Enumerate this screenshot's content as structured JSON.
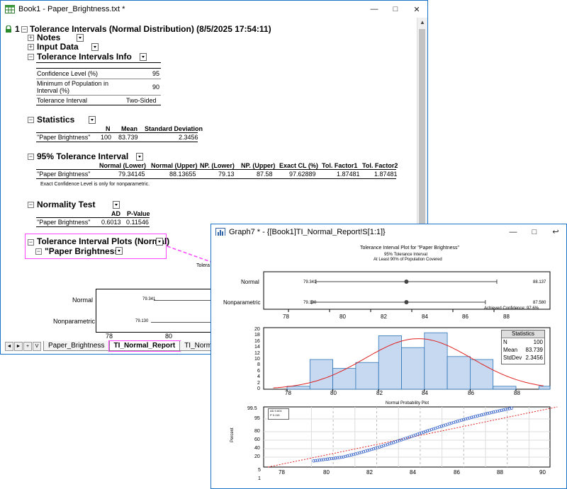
{
  "book": {
    "title": "Book1 - Paper_Brightness.txt *",
    "controls": [
      "—",
      "□",
      "✕"
    ],
    "root_num": "1",
    "header": "Tolerance Intervals (Normal Distribution) (8/5/2025 17:54:11)",
    "sections": {
      "notes": "Notes",
      "input": "Input Data",
      "info": "Tolerance Intervals Info",
      "stats": "Statistics",
      "ti": "95% Tolerance Interval",
      "norm": "Normality Test",
      "plots": "Tolerance Interval Plots (Normal)",
      "sub": "\"Paper Brightness\""
    },
    "info_rows": [
      {
        "label": "Confidence Level (%)",
        "value": "95"
      },
      {
        "label": "Minimum of Population in",
        "label2": "Interval (%)",
        "value": "90"
      },
      {
        "label": "Tolerance Interval",
        "value": "Two-Sided"
      }
    ],
    "stats_table": {
      "headers": [
        "N",
        "Mean",
        "Standard Deviation"
      ],
      "row_label": "\"Paper Brightness\"",
      "values": [
        "100",
        "83.739",
        "2.3456"
      ]
    },
    "ti_table": {
      "headers": [
        "Normal (Lower)",
        "Normal (Upper)",
        "NP. (Lower)",
        "NP. (Upper)",
        "Exact CL (%)",
        "Tol. Factor1",
        "Tol. Factor2"
      ],
      "row_label": "\"Paper Brightness\"",
      "values": [
        "79.34145",
        "88.13655",
        "79.13",
        "87.58",
        "97.62889",
        "1.87481",
        "1.87481"
      ],
      "note": "Exact Confidence Level is only for nonparametric."
    },
    "norm_table": {
      "headers": [
        "AD",
        "P-Value"
      ],
      "row_label": "\"Paper Brightness\"",
      "values": [
        "0.6013",
        "0.11546"
      ]
    },
    "partial_plot": {
      "title_frag": "Tolera",
      "frag2": "A",
      "rows": [
        "Normal",
        "Nonparametric"
      ],
      "left_vals": [
        "79.341",
        "79.130"
      ],
      "ticks": [
        "78",
        "80"
      ]
    },
    "tabs": [
      "Paper_Brightness",
      "TI_Normal_Report",
      "TI_Normal_Data"
    ],
    "nav_buttons": [
      "◄",
      "►",
      "+",
      "V"
    ]
  },
  "graph": {
    "title": "Graph7 * - {[Book1]TI_Normal_Report!S[1:1]}",
    "controls": [
      "—",
      "□",
      "↩"
    ],
    "layer_buttons": [
      "1",
      "2",
      "3"
    ],
    "plot_title": "Tolerance Interval Plot for \"Paper Brightness\"",
    "plot_sub1": "95% Tolerance Interval",
    "plot_sub2": "At Least 90% of Population Covered",
    "interval": {
      "rows": [
        "Normal",
        "Nonparametric"
      ],
      "left_labels": [
        "79.341",
        "79.130"
      ],
      "right_labels": [
        "88.137",
        "87.580"
      ],
      "achieved": "Achieved Confidence: 97.6%",
      "ticks": [
        "78",
        "80",
        "82",
        "84",
        "86",
        "88"
      ]
    },
    "hist": {
      "yticks": [
        "20",
        "18",
        "16",
        "14",
        "12",
        "10",
        "8",
        "6",
        "4",
        "2",
        "0"
      ],
      "xticks": [
        "78",
        "80",
        "82",
        "84",
        "86",
        "88"
      ],
      "stats_title": "Statistics",
      "stats": [
        [
          "N",
          "100"
        ],
        [
          "Mean",
          "83.739"
        ],
        [
          "StdDev",
          "2.3456"
        ]
      ]
    },
    "prob": {
      "title": "Normal Probability Plot",
      "ylabel": "Percent",
      "yticks": [
        "99.5",
        "95",
        "80",
        "60",
        "40",
        "20",
        "5",
        "1"
      ],
      "xticks": [
        "78",
        "80",
        "82",
        "84",
        "86",
        "88",
        "90"
      ],
      "legend1": "AD 0.601",
      "legend2": "P 0.115"
    }
  },
  "chart_data": [
    {
      "type": "scatter",
      "title": "Tolerance Interval Plot for \"Paper Brightness\"",
      "categories": [
        "Normal",
        "Nonparametric"
      ],
      "lower": [
        79.341,
        79.13
      ],
      "upper": [
        88.137,
        87.58
      ],
      "center": [
        83.739,
        83.739
      ],
      "xlim": [
        77,
        90
      ]
    },
    {
      "type": "bar",
      "bin_edges": [
        78,
        79,
        80,
        81,
        82,
        83,
        84,
        85,
        86,
        87,
        88,
        89
      ],
      "values": [
        1,
        10,
        7,
        9,
        18,
        14,
        19,
        11,
        10,
        1
      ],
      "ylim": [
        0,
        20
      ],
      "xlim": [
        77.5,
        89
      ]
    }
  ]
}
